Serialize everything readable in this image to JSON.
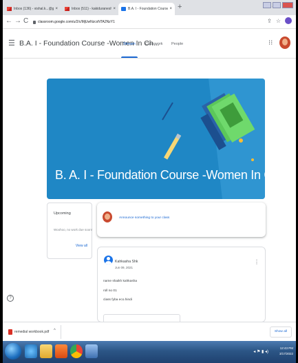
{
  "browser": {
    "tabs": [
      {
        "title": "Inbox (136) - vishal.k...@gm..",
        "active": false,
        "icon": "gmail-icon"
      },
      {
        "title": "Inbox (511) - kakiduraneshiac@gm..",
        "active": false,
        "icon": "gmail-icon"
      },
      {
        "title": "B.A. I - Foundation Course - Wo...",
        "active": true,
        "icon": "classroom-icon"
      }
    ],
    "close_glyph": "×",
    "new_tab_glyph": "+",
    "url": "classroom.google.com/u/2/c/MjUwNzcxNTA2NzY1"
  },
  "header": {
    "class_title": "B.A. I - Foundation Course -Women In Ch...",
    "tabs": [
      "Stream",
      "Classwork",
      "People"
    ],
    "active_tab": "Stream"
  },
  "banner": {
    "title": "B. A. I - Foundation Course -Women In Changing India...",
    "color": "#1f87c5"
  },
  "upcoming": {
    "title": "Upcoming",
    "note": "Woohoo, no work due soon!",
    "view_all": "View all"
  },
  "announce": {
    "placeholder": "Announce something to your class"
  },
  "post": {
    "author": "Kahkasha Shk",
    "date": "Jun 09, 2021",
    "lines": [
      "name shaikh kahkasha",
      "roll no 01",
      "class fyba eco.hindi"
    ]
  },
  "downloads": {
    "file_name": "remedial workbook.pdf",
    "show_all": "Show all"
  },
  "taskbar": {
    "time": "12:43 PM",
    "date": "3/17/2022"
  }
}
